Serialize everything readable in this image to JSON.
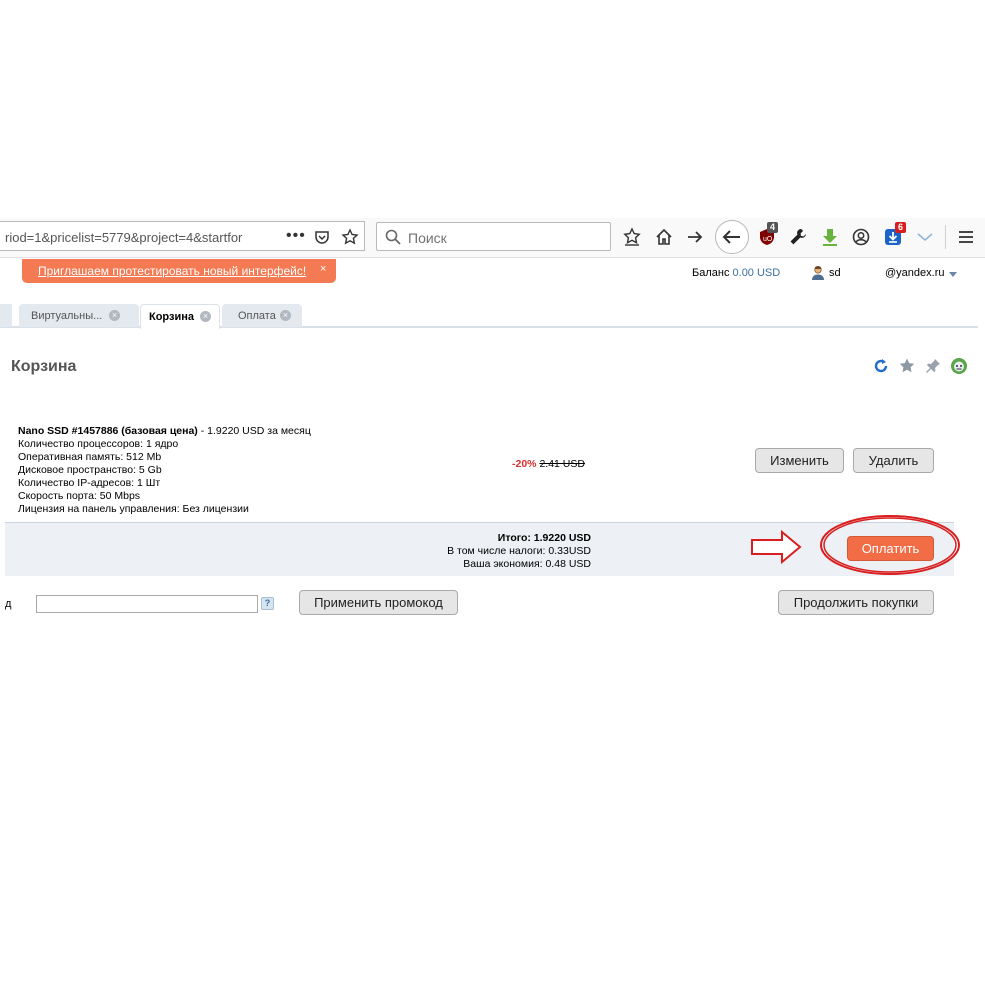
{
  "browser": {
    "url": "riod=1&pricelist=5779&project=4&startfor",
    "url_more": "•••",
    "search_placeholder": "Поиск",
    "ublock_badge": "4",
    "download_badge": "6"
  },
  "topbar": {
    "promo_link": "Приглашаем протестировать новый интерфейс!",
    "promo_close": "×",
    "balance_label": "Баланс ",
    "balance_value": "0.00 USD",
    "user_name": "sd",
    "email": "@yandex.ru"
  },
  "tabs": [
    {
      "label": "Виртуальны...",
      "active": false
    },
    {
      "label": "Корзина",
      "active": true
    },
    {
      "label": "Оплата",
      "active": false
    }
  ],
  "tab_close": "×",
  "page": {
    "title": "Корзина",
    "icons": [
      "refresh-icon",
      "star-icon",
      "pin-icon",
      "help-robot-icon"
    ]
  },
  "product": {
    "name": "Nano SSD #1457886 (базовая цена)",
    "price_line": " - 1.9220 USD за месяц",
    "specs": [
      "Количество процессоров: 1 ядро",
      "Оперативная память: 512 Mb",
      "Дисковое пространство: 5 Gb",
      "Количество IP-адресов: 1 Шт",
      "Скорость порта: 50 Mbps",
      "Лицензия на панель управления: Без лицензии"
    ],
    "discount": "-20%",
    "old_price": "2.41 USD",
    "edit_button": "Изменить",
    "delete_button": "Удалить"
  },
  "totals": {
    "total": "Итого: 1.9220 USD",
    "taxes": "В том числе налоги: 0.33USD",
    "savings": "Ваша экономия: 0.48 USD",
    "pay_button": "Оплатить"
  },
  "promo": {
    "label": "д",
    "input_value": "",
    "help": "?",
    "apply_button": "Применить промокод",
    "continue_button": "Продолжить покупки"
  },
  "colors": {
    "accent": "#f26c45",
    "annotation": "#d81e1e",
    "link": "#3a6fa5"
  }
}
